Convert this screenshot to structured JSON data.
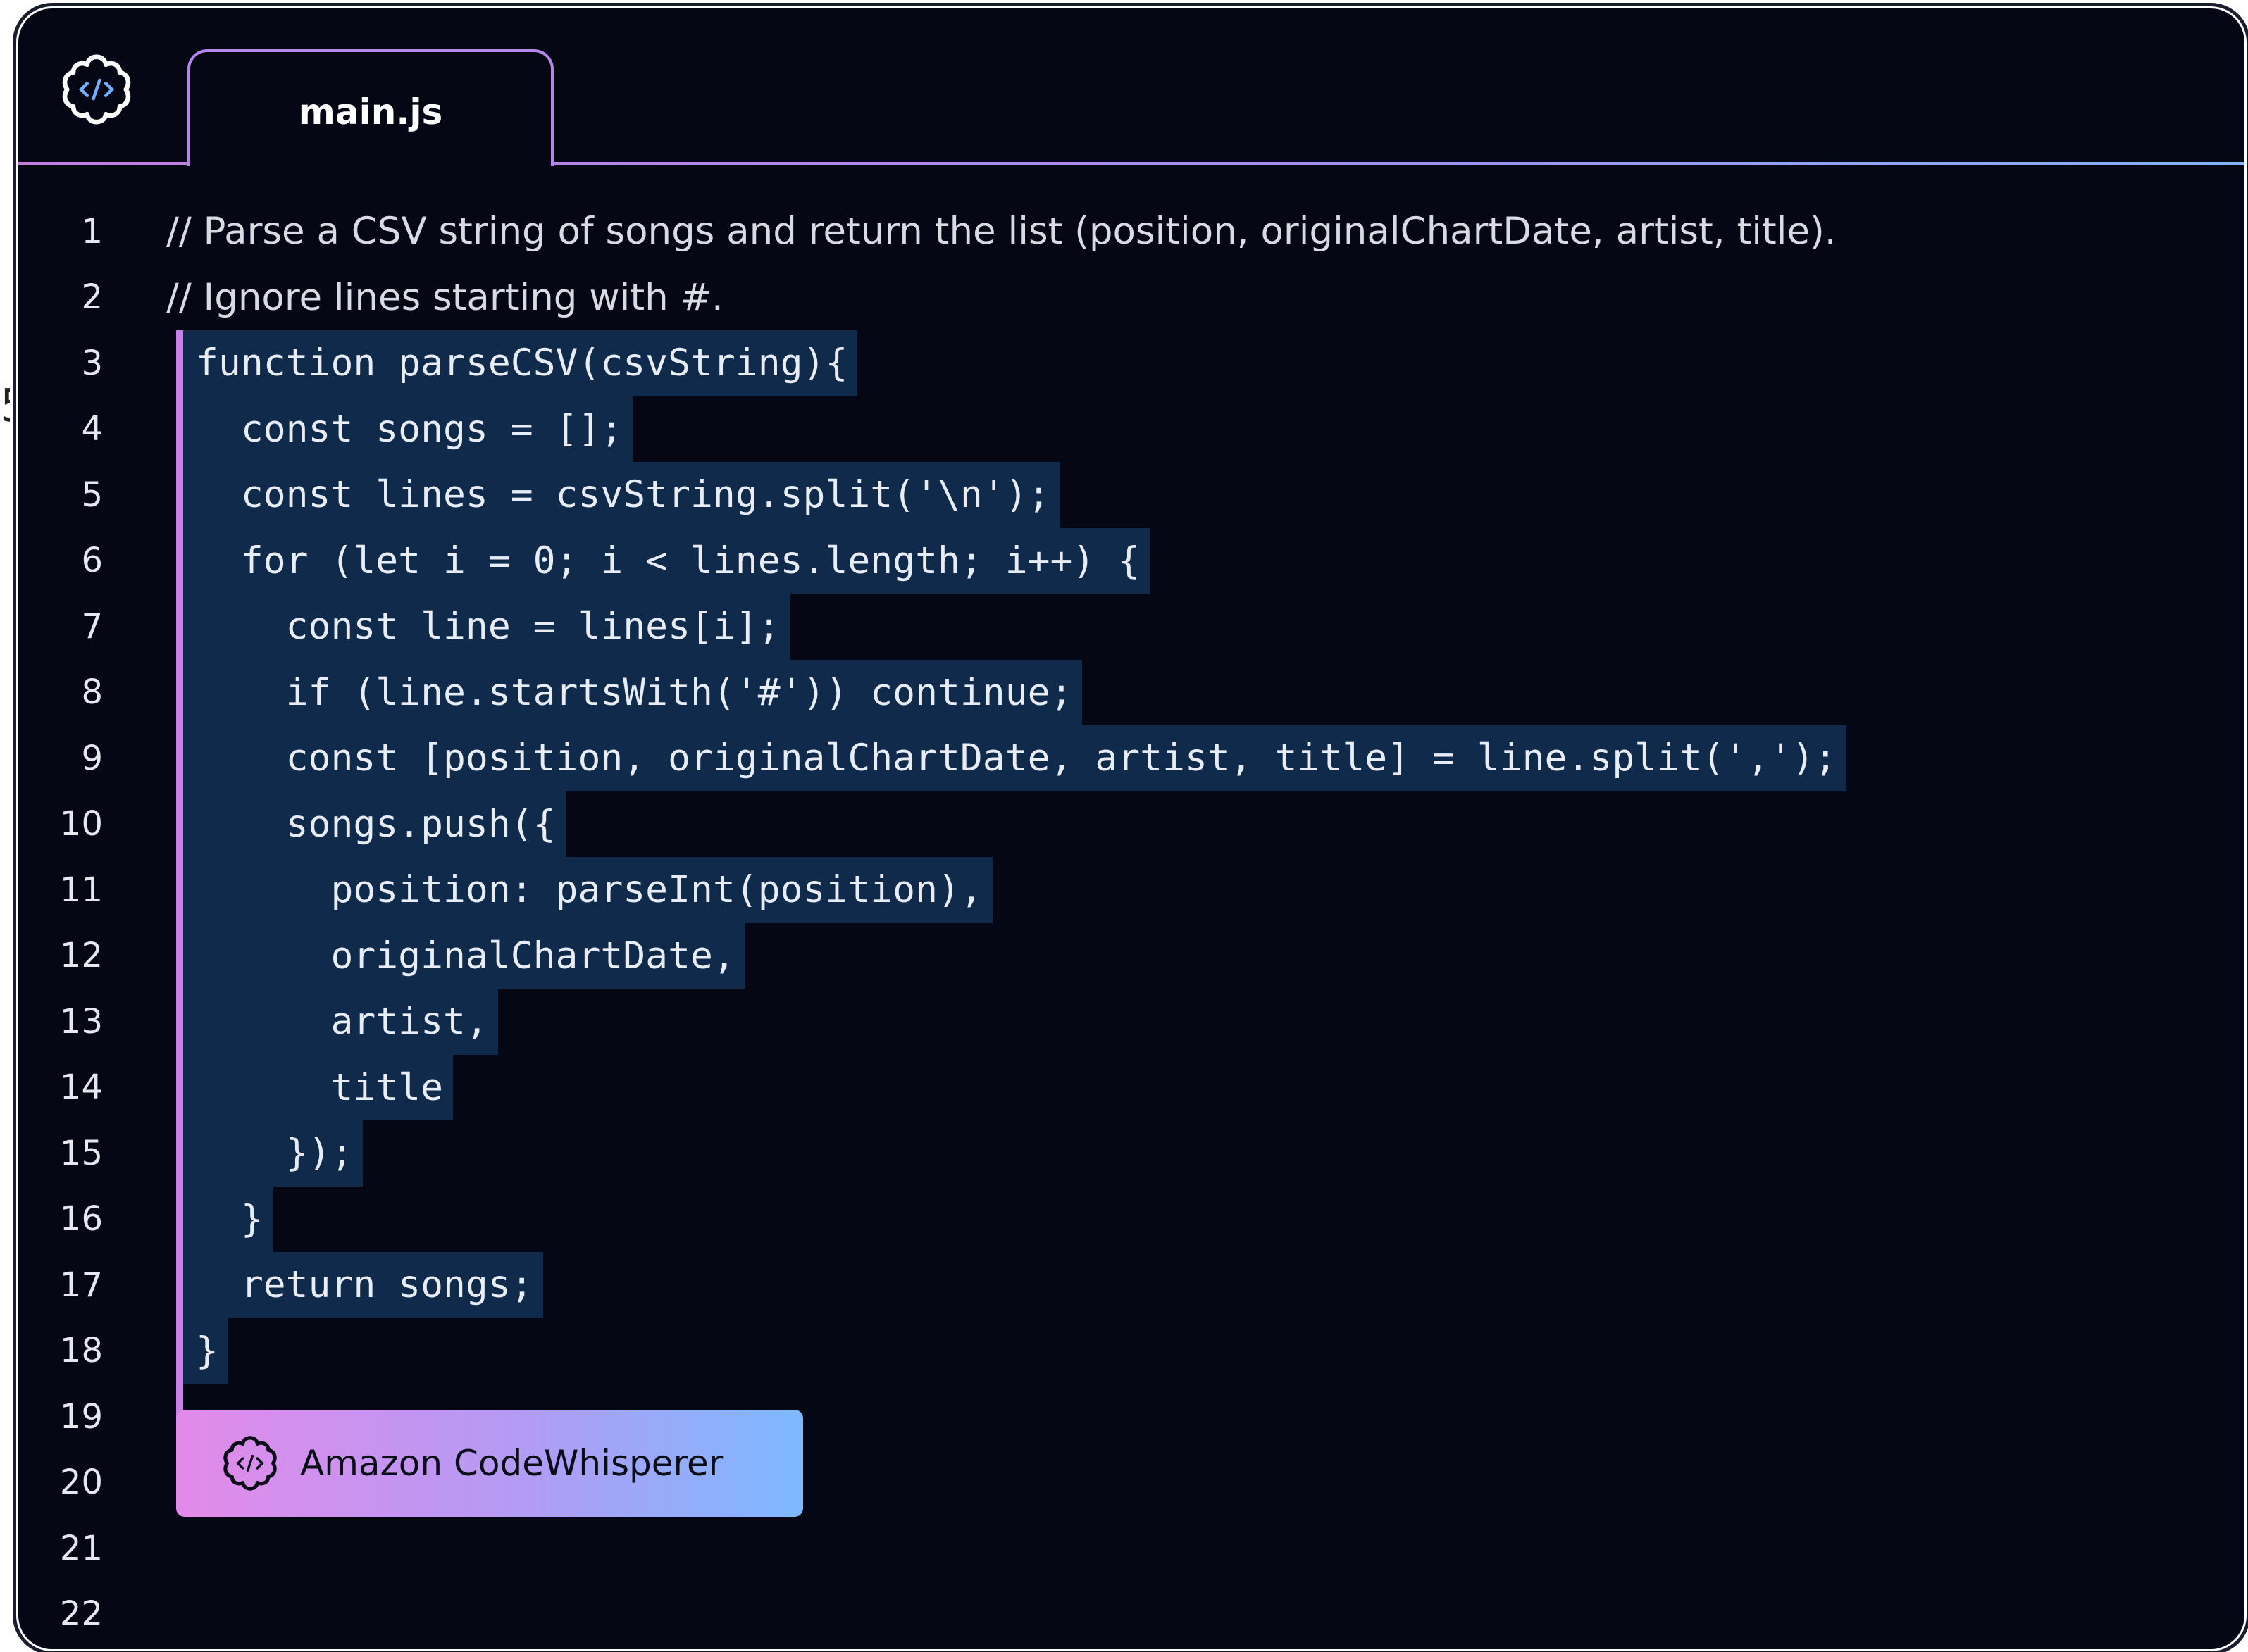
{
  "editor": {
    "logo_icon": "codewhisperer-logo-icon",
    "tab": {
      "label": "main.js"
    }
  },
  "code": {
    "comments": [
      "// Parse a CSV string of songs and return the list (position, originalChartDate, artist, title).",
      "// Ignore lines starting with #."
    ],
    "highlighted": [
      "function parseCSV(csvString){",
      "  const songs = [];",
      "  const lines = csvString.split('\\n');",
      "  for (let i = 0; i < lines.length; i++) {",
      "    const line = lines[i];",
      "    if (line.startsWith('#')) continue;",
      "    const [position, originalChartDate, artist, title] = line.split(',');",
      "    songs.push({",
      "      position: parseInt(position),",
      "      originalChartDate,",
      "      artist,",
      "      title",
      "    });",
      "  }",
      "  return songs;",
      "}"
    ],
    "line_numbers": [
      "1",
      "2",
      "3",
      "4",
      "5",
      "6",
      "7",
      "8",
      "9",
      "10",
      "11",
      "12",
      "13",
      "14",
      "15",
      "16",
      "17",
      "18",
      "19",
      "20",
      "21",
      "22"
    ]
  },
  "suggestion_badge": {
    "label": "Amazon CodeWhisperer",
    "icon": "codewhisperer-logo-icon"
  },
  "colors": {
    "background": "#050814",
    "selection": "#0f2a4a",
    "selection_bar": "#cc7fe8",
    "gradient_start": "#e38ae9",
    "gradient_end": "#7db9ff"
  }
}
